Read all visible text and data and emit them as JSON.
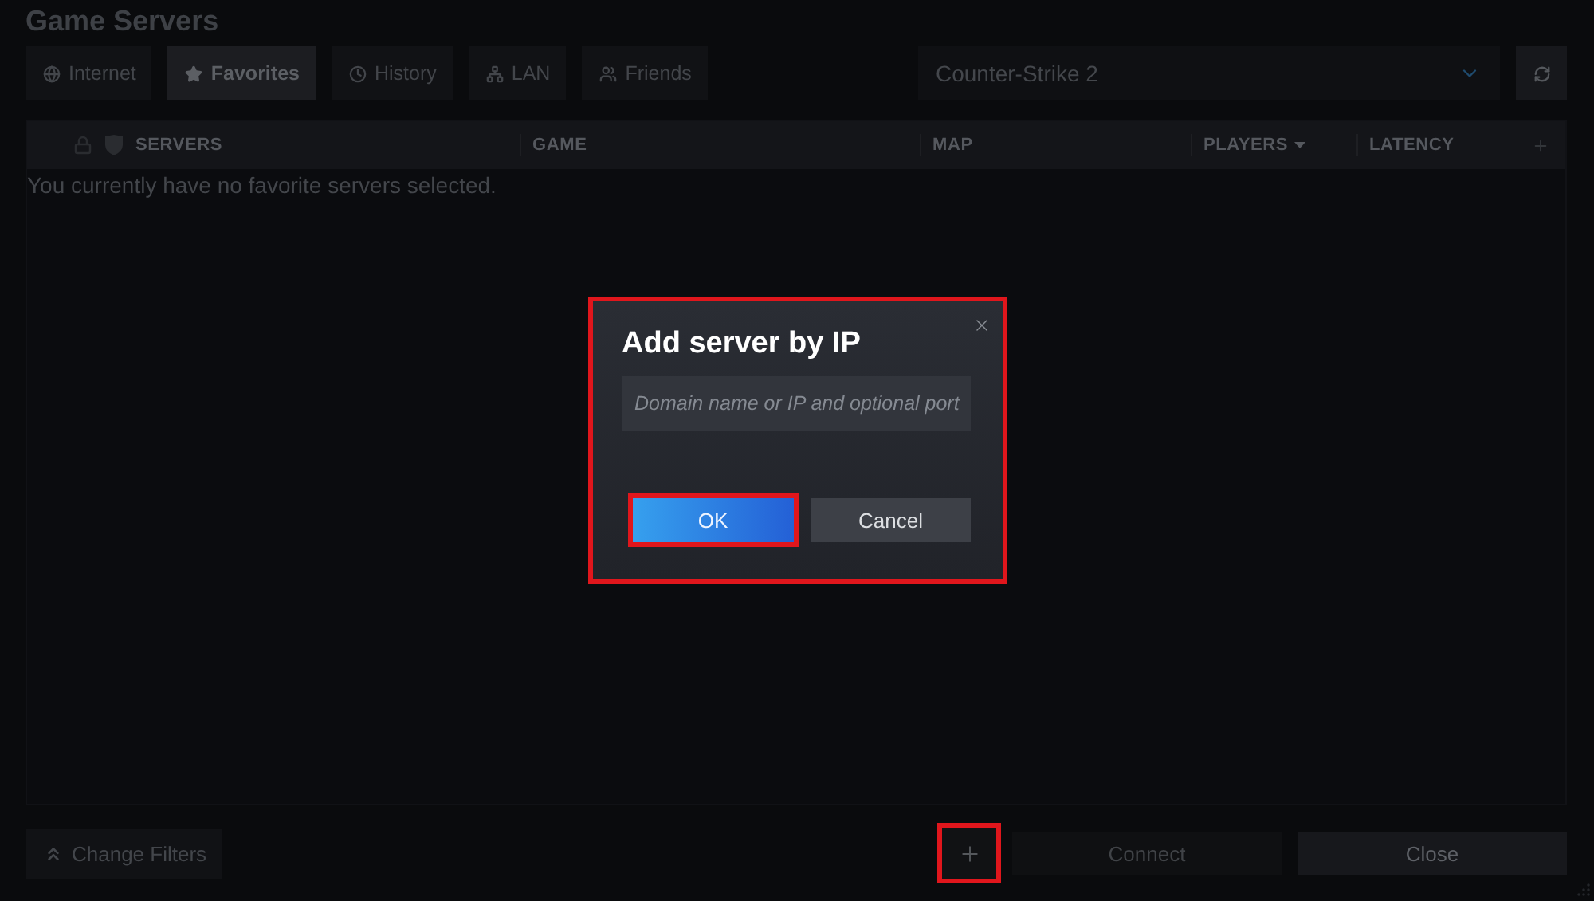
{
  "window": {
    "title": "Game Servers"
  },
  "tabs": [
    {
      "label": "Internet",
      "selected": false
    },
    {
      "label": "Favorites",
      "selected": true
    },
    {
      "label": "History",
      "selected": false
    },
    {
      "label": "LAN",
      "selected": false
    },
    {
      "label": "Friends",
      "selected": false
    }
  ],
  "game_filter": {
    "value": "Counter-Strike 2"
  },
  "table": {
    "columns": [
      {
        "label": "SERVERS",
        "sorted": false
      },
      {
        "label": "GAME",
        "sorted": false
      },
      {
        "label": "MAP",
        "sorted": false
      },
      {
        "label": "PLAYERS",
        "sorted": true
      },
      {
        "label": "LATENCY",
        "sorted": false
      }
    ],
    "empty_message": "You currently have no favorite servers selected."
  },
  "footer": {
    "change_filters": {
      "label": "Change Filters"
    },
    "add_server": {
      "highlighted": true
    },
    "connect": {
      "label": "Connect",
      "disabled": true
    },
    "close": {
      "label": "Close"
    }
  },
  "dialog": {
    "title": "Add server by IP",
    "highlighted": true,
    "input": {
      "placeholder": "Domain name or IP and optional port"
    },
    "buttons": [
      {
        "label": "OK",
        "kind": "primary",
        "highlighted": true
      },
      {
        "label": "Cancel",
        "kind": "secondary",
        "highlighted": false
      }
    ]
  }
}
